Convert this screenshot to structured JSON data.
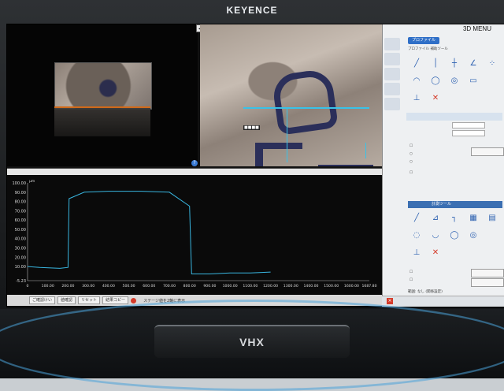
{
  "brand": "KEYENCE",
  "model": "VHX",
  "panel_title": "3D MENU",
  "profile_tab": "プロファイル",
  "subtabs": [
    "プロファイル",
    "補助ツール"
  ],
  "measure_tab": "計測ツール",
  "icons": {
    "help": "?",
    "close": "×",
    "stage": "stage-icon"
  },
  "graph": {
    "y_ticks": [
      "100.00",
      "90.00",
      "80.00",
      "70.00",
      "60.00",
      "50.00",
      "40.00",
      "30.00",
      "20.00",
      "10.00",
      "-5.23"
    ],
    "x_ticks": [
      "0",
      "100.00",
      "200.00",
      "300.00",
      "400.00",
      "500.00",
      "600.00",
      "700.00",
      "800.00",
      "900.00",
      "1000.00",
      "1100.00",
      "1200.00",
      "1300.00",
      "1400.00",
      "1500.00",
      "1600.00",
      "1687.80"
    ],
    "unit": "μm",
    "series_color": "#39b6e0"
  },
  "chart_data": {
    "type": "line",
    "x": [
      0,
      60,
      160,
      200,
      205,
      280,
      400,
      560,
      700,
      800,
      810,
      900,
      1000,
      1100,
      1200
    ],
    "y": [
      10,
      9,
      8,
      9,
      83,
      90,
      91,
      91,
      90,
      75,
      2,
      2,
      3,
      3,
      4
    ],
    "xlim": [
      0,
      1687.8
    ],
    "ylim": [
      -5.23,
      100
    ],
    "x_ticks": [
      "0",
      "100.00",
      "200.00",
      "300.00",
      "400.00",
      "500.00",
      "600.00",
      "700.00",
      "800.00",
      "900.00",
      "1000.00",
      "1100.00",
      "1200.00",
      "1300.00",
      "1400.00",
      "1500.00",
      "1600.00",
      "1687.80"
    ],
    "y_ticks": [
      "100.00",
      "90.00",
      "80.00",
      "70.00",
      "60.00",
      "50.00",
      "40.00",
      "30.00",
      "20.00",
      "10.00",
      "-5.23"
    ],
    "title": "",
    "xlabel": "",
    "ylabel": "μm",
    "grid": false
  },
  "buttons": {
    "bottom": [
      "ご確認けい",
      "値確認",
      "リセット",
      "結果コピー"
    ],
    "stage_note": "ステージ値を2軸に表示",
    "panel_bottom_note": "範囲: なし  (関係設定)"
  }
}
